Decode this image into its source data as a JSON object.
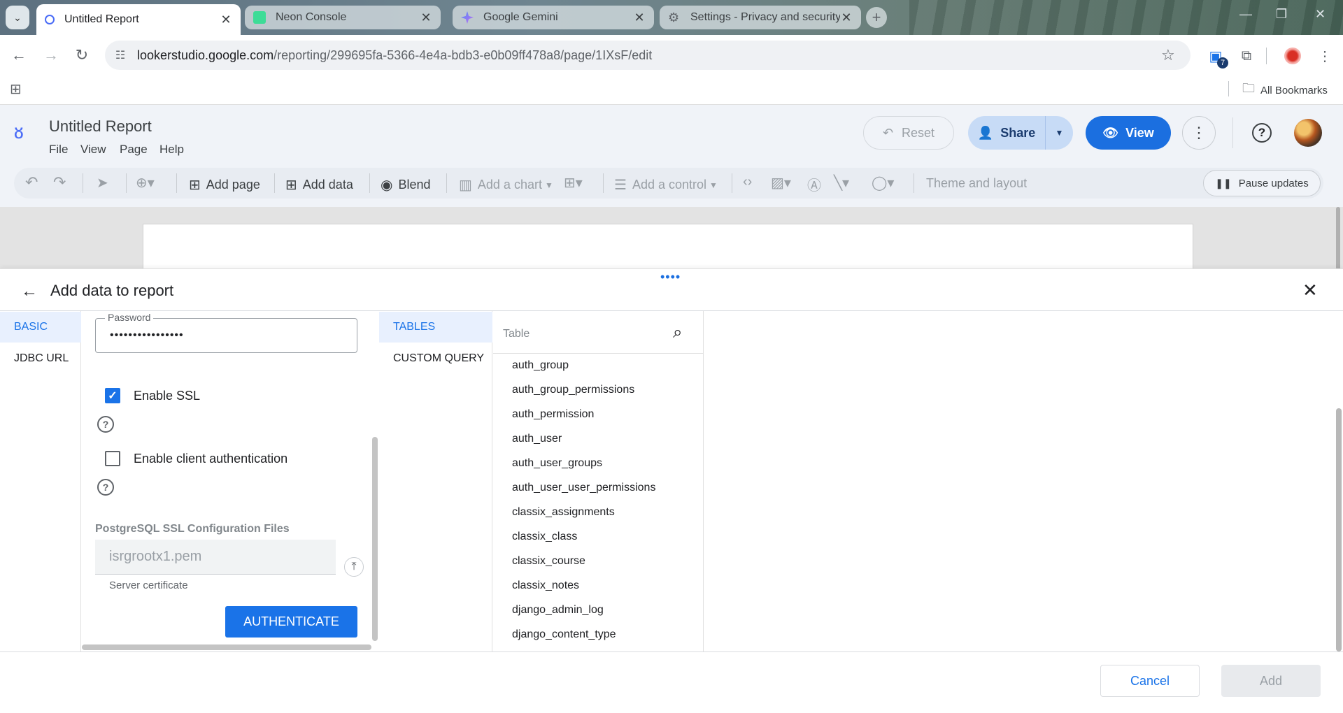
{
  "browser": {
    "tabs": [
      {
        "title": "Untitled Report",
        "favicon_color": "#4a6cf7",
        "active": true
      },
      {
        "title": "Neon Console",
        "favicon_color": "#3ddc97",
        "active": false
      },
      {
        "title": "Google Gemini",
        "favicon_color": "#8e7cf0",
        "active": false
      },
      {
        "title": "Settings - Privacy and security",
        "favicon_color": "#5f6368",
        "active": false
      }
    ],
    "close_glyph": "✕",
    "new_tab_glyph": "+",
    "url_host": "lookerstudio.google.com",
    "url_path": "/reporting/299695fa-5366-4e4a-bdb3-e0b09ff478a8/page/1IXsF/edit",
    "extension_badge": "7",
    "bookmarks_label": "All Bookmarks"
  },
  "app": {
    "report_title": "Untitled Report",
    "menus": [
      "File",
      "View",
      "Page",
      "Help"
    ],
    "reset_label": "Reset",
    "share_label": "Share",
    "view_label": "View",
    "toolbar": {
      "add_page": "Add page",
      "add_data": "Add data",
      "blend": "Blend",
      "add_chart": "Add a chart",
      "add_control": "Add a control",
      "theme_layout": "Theme and layout",
      "pause_updates": "Pause updates"
    }
  },
  "panel": {
    "title": "Add data to report",
    "side_nav": [
      {
        "label": "BASIC",
        "active": true
      },
      {
        "label": "JDBC URL",
        "active": false
      }
    ],
    "form": {
      "password_label": "Password",
      "password_value": "••••••••••••••••",
      "enable_ssl_label": "Enable SSL",
      "enable_ssl_checked": true,
      "enable_client_auth_label": "Enable client authentication",
      "enable_client_auth_checked": false,
      "ssl_files_heading": "PostgreSQL SSL Configuration Files",
      "cert_placeholder": "isrgrootx1.pem",
      "cert_helper": "Server certificate",
      "authenticate_label": "AUTHENTICATE"
    },
    "query_tabs": [
      {
        "label": "TABLES",
        "active": true
      },
      {
        "label": "CUSTOM QUERY",
        "active": false
      }
    ],
    "table_search_placeholder": "Table",
    "tables": [
      "auth_group",
      "auth_group_permissions",
      "auth_permission",
      "auth_user",
      "auth_user_groups",
      "auth_user_user_permissions",
      "classix_assignments",
      "classix_class",
      "classix_course",
      "classix_notes",
      "django_admin_log",
      "django_content_type"
    ],
    "cancel_label": "Cancel",
    "add_label": "Add"
  },
  "colors": {
    "accent": "#1a73e8",
    "view_button": "#1b6fe0",
    "share_button": "#c7dbf6"
  }
}
